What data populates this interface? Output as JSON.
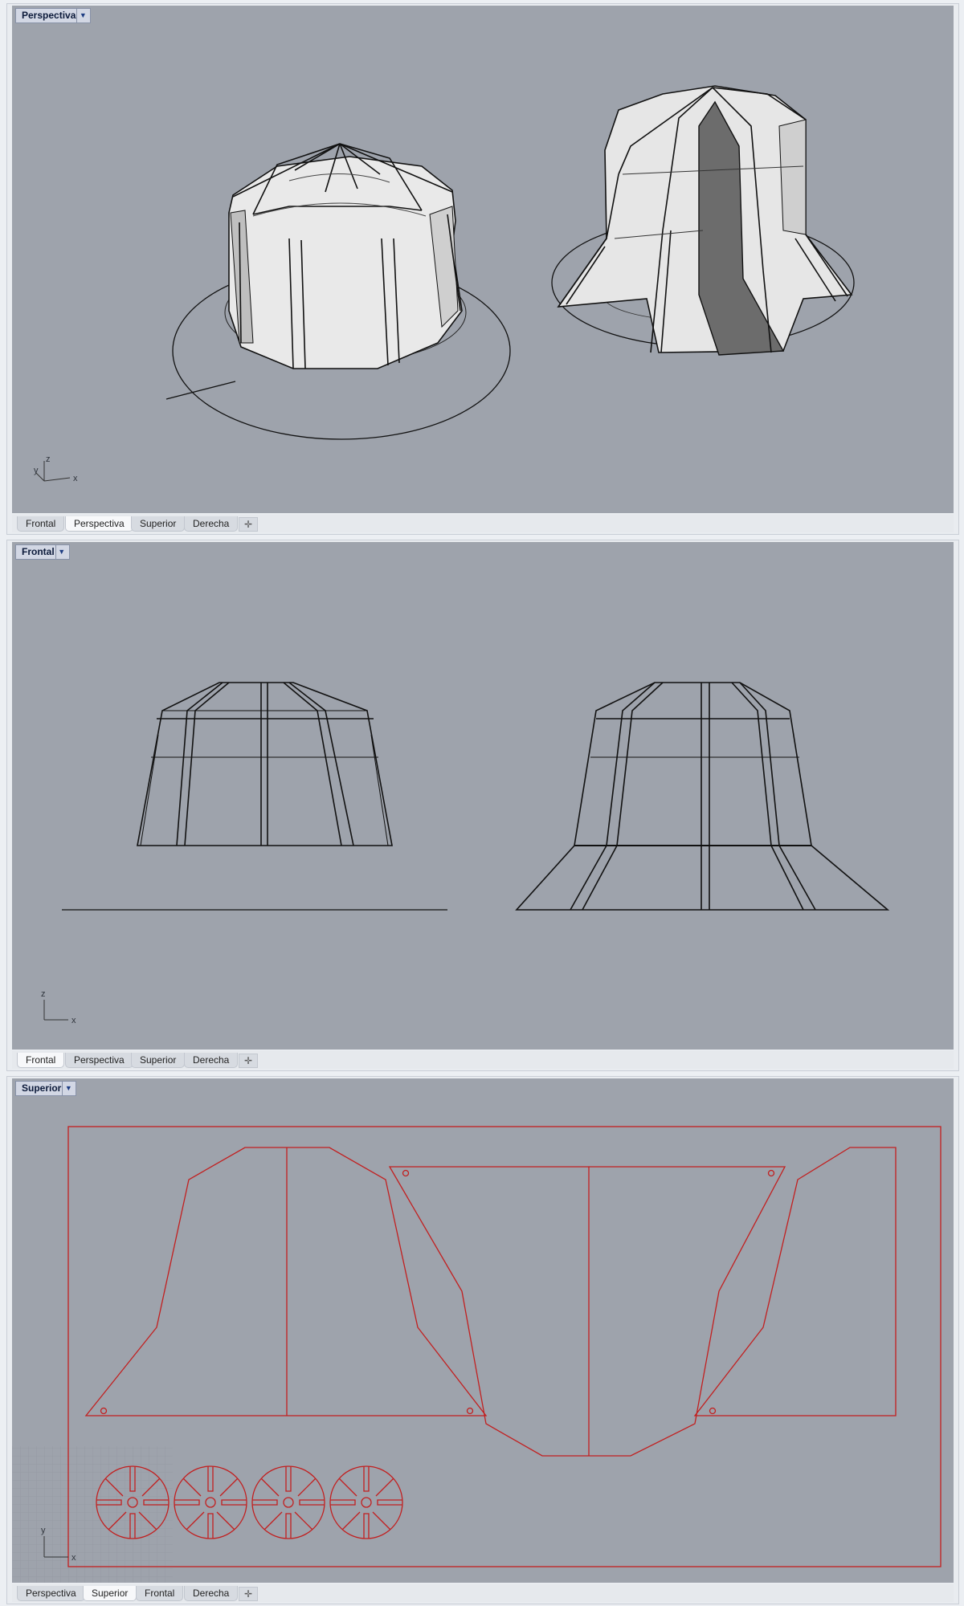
{
  "viewports": [
    {
      "title": "Perspectiva",
      "tabs": [
        "Frontal",
        "Perspectiva",
        "Superior",
        "Derecha"
      ],
      "active_tab": 1,
      "axis_labels": [
        "y",
        "z",
        "x"
      ]
    },
    {
      "title": "Frontal",
      "tabs": [
        "Frontal",
        "Perspectiva",
        "Superior",
        "Derecha"
      ],
      "active_tab": 0,
      "axis_labels": [
        "z",
        "x"
      ]
    },
    {
      "title": "Superior",
      "tabs": [
        "Perspectiva",
        "Superior",
        "Frontal",
        "Derecha"
      ],
      "active_tab": 1,
      "axis_labels": [
        "y",
        "x"
      ]
    }
  ],
  "icons": {
    "dropdown": "chevron-down-icon",
    "add_viewport": "plus-icon"
  },
  "colors": {
    "viewport_bg": "#9ea3ac",
    "cut_lines": "#c21f1f",
    "model_lines": "#111111"
  }
}
